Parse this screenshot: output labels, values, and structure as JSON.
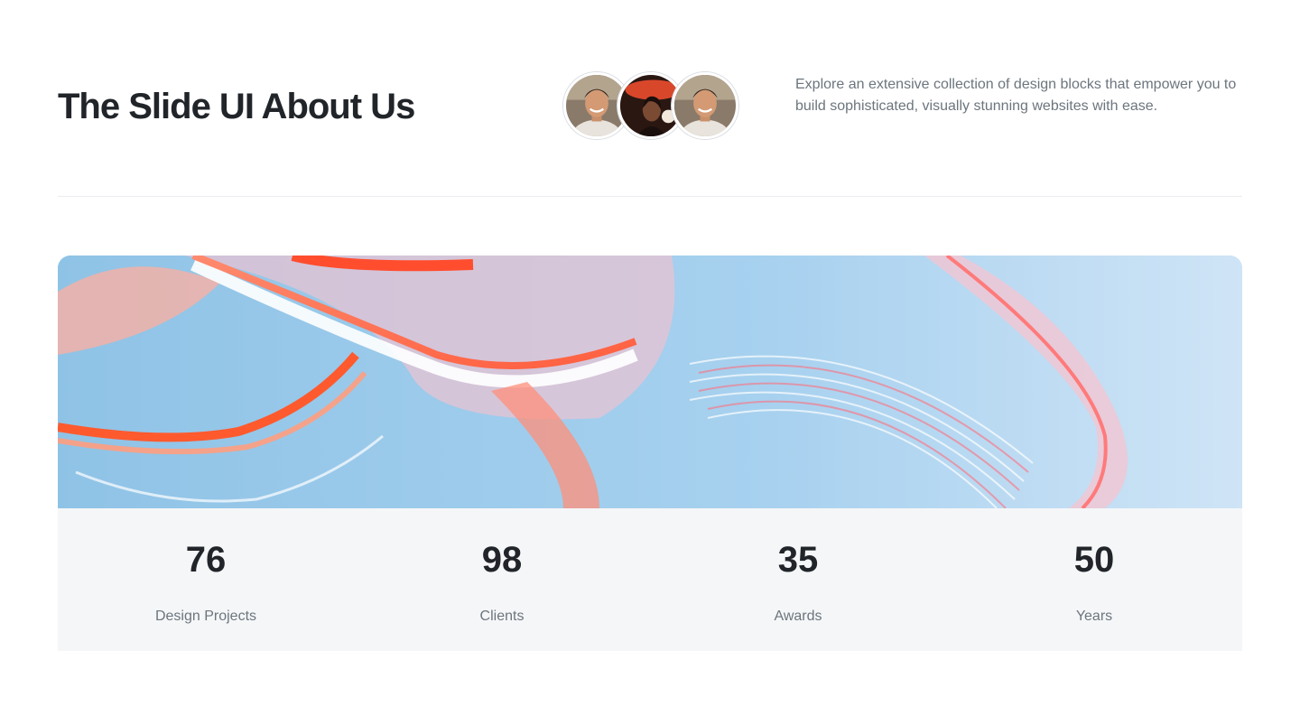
{
  "header": {
    "title": "The Slide UI About Us",
    "description": "Explore an extensive collection of design blocks that empower you to build sophisticated, visually stunning websites with ease."
  },
  "avatars": [
    {
      "name": "person-avatar-1"
    },
    {
      "name": "person-avatar-2"
    },
    {
      "name": "person-avatar-3"
    }
  ],
  "stats": [
    {
      "value": "76",
      "label": "Design Projects"
    },
    {
      "value": "98",
      "label": "Clients"
    },
    {
      "value": "35",
      "label": "Awards"
    },
    {
      "value": "50",
      "label": "Years"
    }
  ],
  "colors": {
    "heading": "#212529",
    "muted": "#6c757d",
    "stats_background": "#f5f6f8",
    "banner_sky": "#a9d0ec",
    "banner_accent": "#ff6a4a"
  }
}
